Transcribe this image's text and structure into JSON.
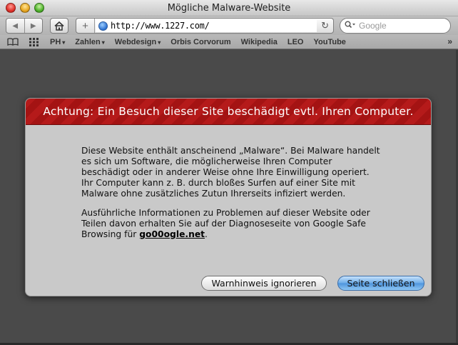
{
  "window": {
    "title": "Mögliche Malware-Website"
  },
  "toolbar": {
    "back_icon": "◀",
    "forward_icon": "▶",
    "add_icon": "+",
    "url": "http://www.1227.com/",
    "reload_icon": "↻",
    "search_placeholder": "Google",
    "search_icon": "🔍︎▾"
  },
  "bookmarks": {
    "items": [
      {
        "label": "PH",
        "has_menu": true,
        "arrow": "▾"
      },
      {
        "label": "Zahlen",
        "has_menu": true,
        "arrow": "▾"
      },
      {
        "label": "Webdesign",
        "has_menu": true,
        "arrow": "▾"
      },
      {
        "label": "Orbis Corvorum",
        "has_menu": false,
        "arrow": ""
      },
      {
        "label": "Wikipedia",
        "has_menu": false,
        "arrow": ""
      },
      {
        "label": "LEO",
        "has_menu": false,
        "arrow": ""
      },
      {
        "label": "YouTube",
        "has_menu": false,
        "arrow": ""
      }
    ],
    "more_icon": "»"
  },
  "dialog": {
    "title": "Achtung: Ein Besuch dieser Site beschädigt evtl. Ihren Computer.",
    "paragraph1": "Diese Website enthält anscheinend „Malware“. Bei Malware handelt es sich um Software, die möglicherweise Ihren Computer beschädigt oder in anderer Weise ohne Ihre Einwilligung operiert. Ihr Computer kann z. B. durch bloßes Surfen auf einer Site mit Malware ohne zusätzliches Zutun Ihrerseits infiziert werden.",
    "paragraph2_prefix": "Ausführliche Informationen zu Problemen auf dieser Website oder Teilen davon erhalten Sie auf der Diagnoseseite von Google Safe Browsing für ",
    "paragraph2_link": "go00ogle.net",
    "paragraph2_suffix": ".",
    "ignore_button": "Warnhinweis ignorieren",
    "close_button": "Seite schließen"
  },
  "colors": {
    "header_red": "#b51a1a",
    "dialog_bg": "#c9c9c9",
    "page_bg": "#4a4a4a",
    "primary_button": "#6aaae8"
  }
}
